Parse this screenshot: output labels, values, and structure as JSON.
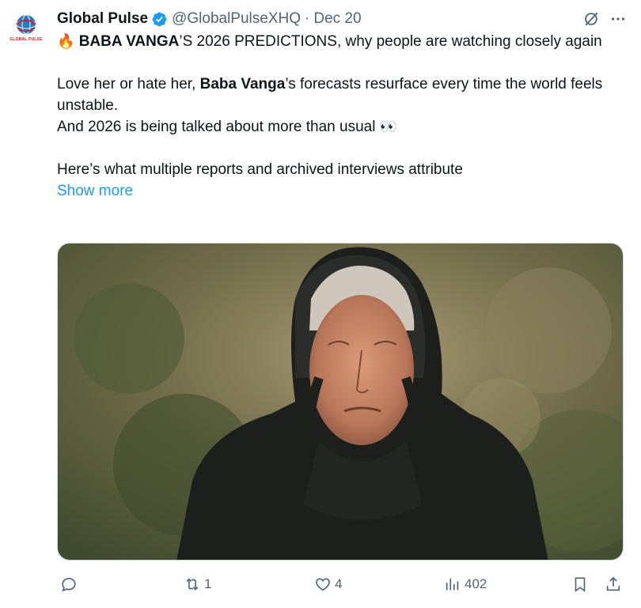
{
  "author": {
    "name": "Global Pulse",
    "handle": "@GlobalPulseXHQ",
    "separator": "·",
    "date": "Dec 20",
    "avatar_text": "GLOBAL PULSE"
  },
  "post": {
    "line1_emoji": "🔥",
    "line1_bold": "BABA VANGA",
    "line1_rest": "’S 2026 PREDICTIONS, why people are watching closely again",
    "para2_pre": "Love her or hate her, ",
    "para2_bold": "Baba Vanga",
    "para2_post": "’s forecasts resurface every time the world feels unstable.",
    "para3": "And 2026 is being talked about more than usual",
    "para3_emoji": "👀",
    "para4": "Here’s what multiple reports and archived interviews attribute",
    "show_more": "Show more"
  },
  "actions": {
    "reply_count": "",
    "repost_count": "1",
    "like_count": "4",
    "views_count": "402"
  },
  "colors": {
    "accent": "#1d9bf0",
    "muted": "#536471",
    "text": "#0f1419",
    "verified": "#1d9bf0",
    "brand_red": "#c8202b"
  },
  "icons": [
    "verified-badge-icon",
    "grok-icon",
    "more-icon",
    "reply-icon",
    "repost-icon",
    "like-icon",
    "views-icon",
    "bookmark-icon",
    "share-icon"
  ]
}
